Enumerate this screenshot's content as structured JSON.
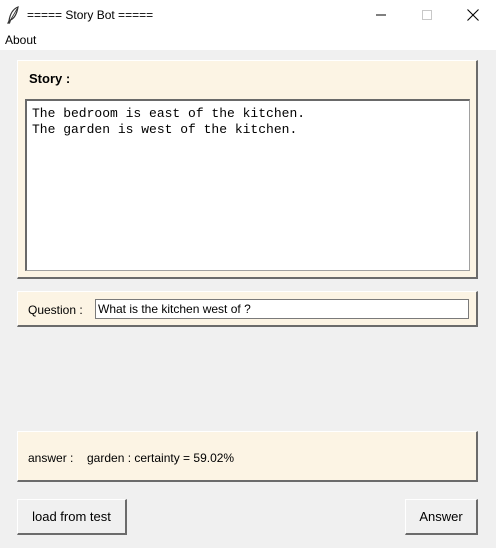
{
  "window": {
    "title": "===== Story Bot =====",
    "icon": "feather-icon"
  },
  "menu": {
    "items": [
      {
        "label": "About"
      }
    ]
  },
  "story": {
    "label": "Story :",
    "text": "The bedroom is east of the kitchen.\nThe garden is west of the kitchen."
  },
  "question": {
    "label": "Question :",
    "value": "What is the kitchen west of ?"
  },
  "answer": {
    "label": "answer :",
    "value": "garden : certainty = 59.02%"
  },
  "buttons": {
    "load_label": "load from test",
    "answer_label": "Answer"
  },
  "colors": {
    "panel_bg": "#fcf4e4",
    "window_bg": "#f0f0f0"
  }
}
